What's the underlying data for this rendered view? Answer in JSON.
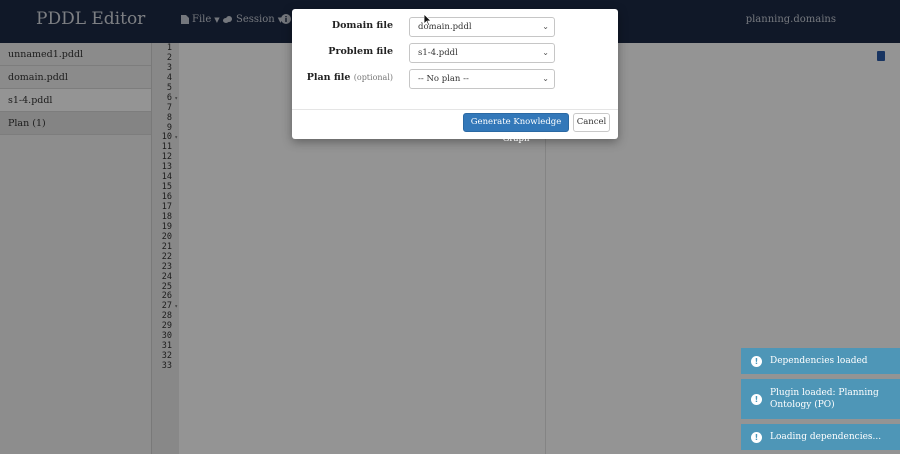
{
  "navbar": {
    "brand": "PDDL Editor",
    "menu": [
      {
        "label": "File",
        "icon": "file-icon"
      },
      {
        "label": "Session",
        "icon": "cloud-icon"
      }
    ],
    "right_link": "planning.domains"
  },
  "sidebar": {
    "items": [
      {
        "label": "unnamed1.pddl"
      },
      {
        "label": "domain.pddl"
      },
      {
        "label": "s1-4.pddl"
      },
      {
        "label": "Plan (1)"
      }
    ]
  },
  "editor": {
    "line_numbers": [
      "1",
      "2",
      "3",
      "4",
      "5",
      "6",
      "7",
      "8",
      "9",
      "10",
      "11",
      "12",
      "13",
      "14",
      "15",
      "16",
      "17",
      "18",
      "19",
      "20",
      "21",
      "22",
      "23",
      "24",
      "25",
      "26",
      "27",
      "28",
      "29",
      "30",
      "31",
      "32",
      "33"
    ]
  },
  "modal": {
    "domain_label": "Domain file",
    "domain_value": "domain.pddl",
    "problem_label": "Problem file",
    "problem_value": "s1-4.pddl",
    "plan_label": "Plan file",
    "plan_optional": "(optional)",
    "plan_value": "-- No plan --",
    "generate_label": "Generate Knowledge Graph",
    "cancel_label": "Cancel"
  },
  "toasts": [
    {
      "text": "Dependencies loaded"
    },
    {
      "text": "Plugin loaded: Planning Ontology (PO)"
    },
    {
      "text": "Loading dependencies..."
    }
  ],
  "colors": {
    "navbar": "#1d2a45",
    "primary_button": "#3378b9",
    "toast": "#4896ba"
  }
}
